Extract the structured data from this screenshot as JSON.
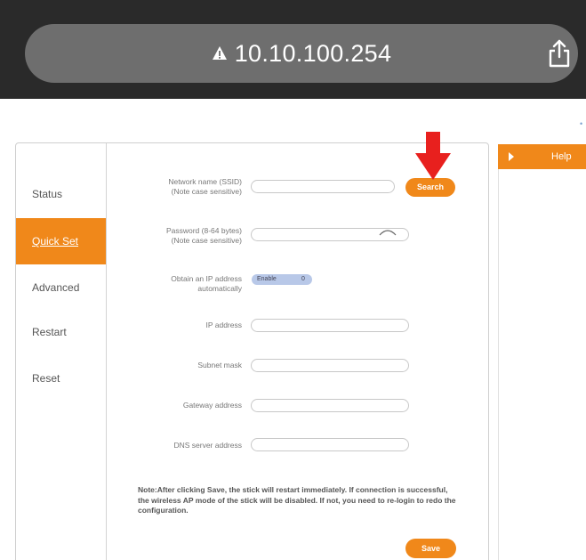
{
  "browser": {
    "url": "10.10.100.254",
    "security_icon": "warning-triangle-icon",
    "share_icon": "share-icon"
  },
  "sidebar": {
    "items": [
      {
        "label": "Status",
        "active": false
      },
      {
        "label": "Quick Set",
        "active": true
      },
      {
        "label": "Advanced",
        "active": false
      },
      {
        "label": "Restart",
        "active": false
      },
      {
        "label": "Reset",
        "active": false
      }
    ]
  },
  "form": {
    "ssid": {
      "label_line1": "Network name (SSID)",
      "label_line2": "(Note case sensitive)",
      "value": ""
    },
    "search_label": "Search",
    "password": {
      "label_line1": "Password (8-64 bytes)",
      "label_line2": "(Note case sensitive)",
      "value": ""
    },
    "dhcp": {
      "label_line1": "Obtain an IP address",
      "label_line2": "automatically",
      "toggle_text": "Enable",
      "toggle_knob": "0"
    },
    "ip": {
      "label": "IP address",
      "value": ""
    },
    "subnet": {
      "label": "Subnet mask",
      "value": ""
    },
    "gateway": {
      "label": "Gateway address",
      "value": ""
    },
    "dns": {
      "label": "DNS server address",
      "value": ""
    },
    "note": "Note:After clicking Save, the stick will restart immediately. If connection is successful, the wireless AP mode of the stick will be disabled. If not, you need to re-login to redo the configuration.",
    "save_label": "Save"
  },
  "help": {
    "label": "Help"
  },
  "colors": {
    "accent": "#f0881a",
    "chrome": "#2a2a2a",
    "url_pill": "#6e6e6e",
    "annotation_arrow": "#e8201e"
  }
}
